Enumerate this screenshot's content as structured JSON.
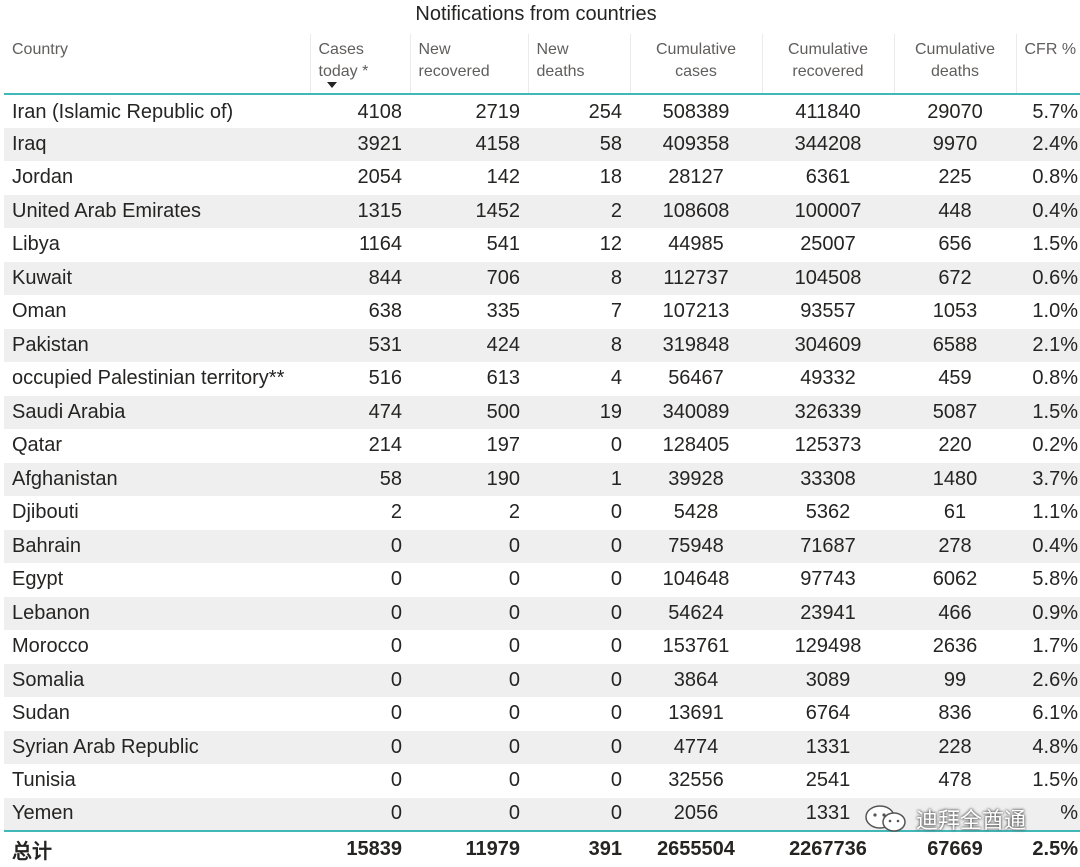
{
  "title": "Notifications from countries",
  "columns": [
    "Country",
    "Cases\ntoday *",
    "New\nrecovered",
    "New\ndeaths",
    "Cumulative\ncases",
    "Cumulative\nrecovered",
    "Cumulative\ndeaths",
    "CFR %"
  ],
  "sort": {
    "column": "Cases today *",
    "direction": "descending"
  },
  "rows": [
    [
      "Iran (Islamic Republic of)",
      "4108",
      "2719",
      "254",
      "508389",
      "411840",
      "29070",
      "5.7%"
    ],
    [
      "Iraq",
      "3921",
      "4158",
      "58",
      "409358",
      "344208",
      "9970",
      "2.4%"
    ],
    [
      "Jordan",
      "2054",
      "142",
      "18",
      "28127",
      "6361",
      "225",
      "0.8%"
    ],
    [
      "United Arab Emirates",
      "1315",
      "1452",
      "2",
      "108608",
      "100007",
      "448",
      "0.4%"
    ],
    [
      "Libya",
      "1164",
      "541",
      "12",
      "44985",
      "25007",
      "656",
      "1.5%"
    ],
    [
      "Kuwait",
      "844",
      "706",
      "8",
      "112737",
      "104508",
      "672",
      "0.6%"
    ],
    [
      "Oman",
      "638",
      "335",
      "7",
      "107213",
      "93557",
      "1053",
      "1.0%"
    ],
    [
      "Pakistan",
      "531",
      "424",
      "8",
      "319848",
      "304609",
      "6588",
      "2.1%"
    ],
    [
      "occupied Palestinian territory**",
      "516",
      "613",
      "4",
      "56467",
      "49332",
      "459",
      "0.8%"
    ],
    [
      "Saudi Arabia",
      "474",
      "500",
      "19",
      "340089",
      "326339",
      "5087",
      "1.5%"
    ],
    [
      "Qatar",
      "214",
      "197",
      "0",
      "128405",
      "125373",
      "220",
      "0.2%"
    ],
    [
      "Afghanistan",
      "58",
      "190",
      "1",
      "39928",
      "33308",
      "1480",
      "3.7%"
    ],
    [
      "Djibouti",
      "2",
      "2",
      "0",
      "5428",
      "5362",
      "61",
      "1.1%"
    ],
    [
      "Bahrain",
      "0",
      "0",
      "0",
      "75948",
      "71687",
      "278",
      "0.4%"
    ],
    [
      "Egypt",
      "0",
      "0",
      "0",
      "104648",
      "97743",
      "6062",
      "5.8%"
    ],
    [
      "Lebanon",
      "0",
      "0",
      "0",
      "54624",
      "23941",
      "466",
      "0.9%"
    ],
    [
      "Morocco",
      "0",
      "0",
      "0",
      "153761",
      "129498",
      "2636",
      "1.7%"
    ],
    [
      "Somalia",
      "0",
      "0",
      "0",
      "3864",
      "3089",
      "99",
      "2.6%"
    ],
    [
      "Sudan",
      "0",
      "0",
      "0",
      "13691",
      "6764",
      "836",
      "6.1%"
    ],
    [
      "Syrian Arab Republic",
      "0",
      "0",
      "0",
      "4774",
      "1331",
      "228",
      "4.8%"
    ],
    [
      "Tunisia",
      "0",
      "0",
      "0",
      "32556",
      "2541",
      "478",
      "1.5%"
    ],
    [
      "Yemen",
      "0",
      "0",
      "0",
      "2056",
      "1331",
      "",
      "%"
    ]
  ],
  "total": [
    "总计",
    "15839",
    "11979",
    "391",
    "2655504",
    "2267736",
    "67669",
    "2.5%"
  ],
  "watermark": {
    "text": "迪拜全酋通",
    "icon": "wechat-icon"
  },
  "colors": {
    "accent": "#40b8b8",
    "stripe": "#efefef",
    "header_text": "#605e5c"
  }
}
